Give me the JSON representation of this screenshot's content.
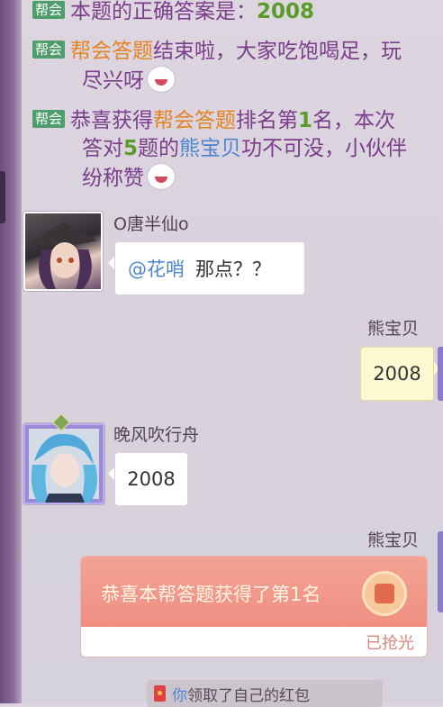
{
  "system_messages": [
    {
      "tag": "帮会",
      "segments": [
        {
          "text": "本题的正确答案是：",
          "style": "normal"
        },
        {
          "text": "2008",
          "style": "grn"
        }
      ]
    },
    {
      "tag": "帮会",
      "line1": [
        {
          "text": "帮会答题",
          "style": "org"
        },
        {
          "text": "结束啦，大家吃饱喝足，玩",
          "style": "normal"
        }
      ],
      "line2": [
        {
          "text": "尽兴呀",
          "style": "normal"
        }
      ]
    },
    {
      "tag": "帮会",
      "line1": [
        {
          "text": "恭喜获得",
          "style": "normal"
        },
        {
          "text": "帮会答题",
          "style": "org"
        },
        {
          "text": "排名第",
          "style": "normal"
        },
        {
          "text": "1",
          "style": "grn"
        },
        {
          "text": "名，本次",
          "style": "normal"
        }
      ],
      "line2": [
        {
          "text": "答对",
          "style": "normal"
        },
        {
          "text": "5",
          "style": "grn"
        },
        {
          "text": "题的",
          "style": "normal"
        },
        {
          "text": "熊宝贝",
          "style": "blu"
        },
        {
          "text": "功不可没，小伙伴",
          "style": "normal"
        }
      ],
      "line3": [
        {
          "text": "纷称赞",
          "style": "normal"
        }
      ]
    }
  ],
  "messages": [
    {
      "sender": "O唐半仙o",
      "mention": "@花哨",
      "text": "那点？？"
    },
    {
      "sender": "熊宝贝",
      "text": "2008"
    },
    {
      "sender": "晚风吹行舟",
      "text": "2008"
    },
    {
      "sender": "熊宝贝",
      "red_packet": {
        "title": "恭喜本帮答题获得了第1名",
        "status": "已抢光"
      }
    }
  ],
  "notice": {
    "you": "你",
    "text": "领取了自己的红包"
  },
  "icons": {
    "emoji1": "laughing-emoji-icon",
    "emoji2": "cheering-emoji-icon",
    "dice": "dice-icon",
    "envelope": "red-envelope-icon"
  },
  "colors": {
    "tag_bg": "#4e9d6d",
    "system_text": "#7a3d8a",
    "highlight_orange": "#e48322",
    "highlight_green": "#5a9c2a",
    "highlight_blue": "#4c86cf"
  }
}
